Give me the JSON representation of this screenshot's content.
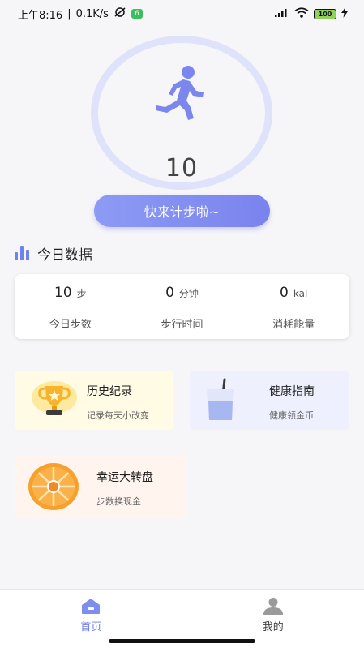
{
  "status_bar": {
    "time": "上午8:16",
    "network_speed": "0.1K/s",
    "badge": "6",
    "battery": "100"
  },
  "step_ring": {
    "step_count": "10",
    "icon": "runner-icon"
  },
  "cta_label": "快来计步啦~",
  "today": {
    "title": "今日数据",
    "stats": [
      {
        "value": "10",
        "unit": "步",
        "label": "今日步数"
      },
      {
        "value": "0",
        "unit": "分钟",
        "label": "步行时间"
      },
      {
        "value": "0",
        "unit": "kal",
        "label": "消耗能量"
      }
    ]
  },
  "features": {
    "history": {
      "title": "历史纪录",
      "subtitle": "记录每天小改变",
      "icon": "trophy-icon"
    },
    "health": {
      "title": "健康指南",
      "subtitle": "健康领金币",
      "icon": "water-glass-icon"
    },
    "wheel": {
      "title": "幸运大转盘",
      "subtitle": "步数换现金",
      "icon": "prize-wheel-icon"
    }
  },
  "nav": {
    "home": "首页",
    "mine": "我的"
  },
  "colors": {
    "accent": "#7a83ee",
    "ring": "#dfe2fb",
    "nav_active": "#6f7fe6"
  }
}
